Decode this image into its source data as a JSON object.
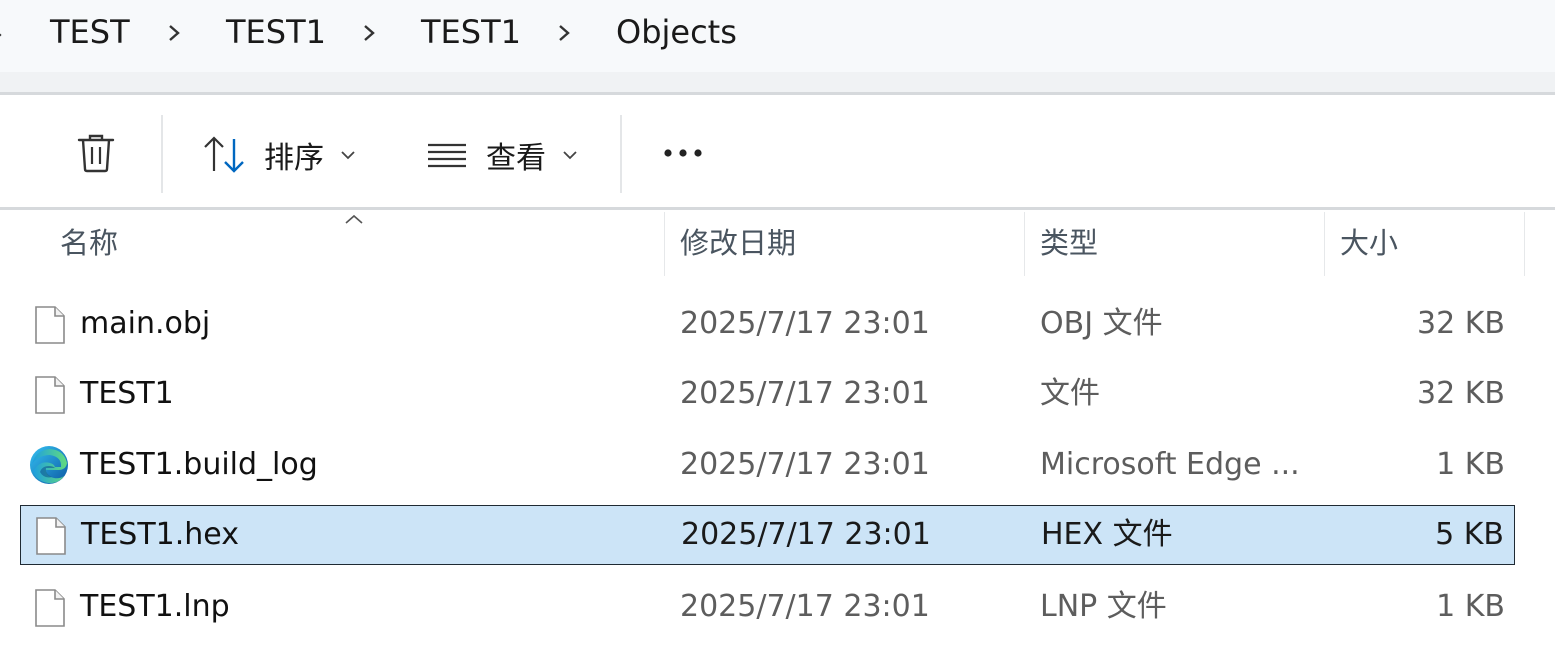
{
  "breadcrumb": {
    "items": [
      "TEST",
      "TEST1",
      "TEST1",
      "Objects"
    ]
  },
  "toolbar": {
    "delete_icon": "trash-icon",
    "sort_label": "排序",
    "view_label": "查看",
    "more_label": "•••"
  },
  "columns": {
    "name": "名称",
    "date": "修改日期",
    "type": "类型",
    "size": "大小"
  },
  "files": [
    {
      "name": "main.obj",
      "date": "2025/7/17 23:01",
      "type": "OBJ 文件",
      "size": "32 KB",
      "icon": "generic-file-icon",
      "selected": false
    },
    {
      "name": "TEST1",
      "date": "2025/7/17 23:01",
      "type": "文件",
      "size": "32 KB",
      "icon": "generic-file-icon",
      "selected": false
    },
    {
      "name": "TEST1.build_log",
      "date": "2025/7/17 23:01",
      "type": "Microsoft Edge ...",
      "size": "1 KB",
      "icon": "edge-browser-icon",
      "selected": false
    },
    {
      "name": "TEST1.hex",
      "date": "2025/7/17 23:01",
      "type": "HEX 文件",
      "size": "5 KB",
      "icon": "generic-file-icon",
      "selected": true
    },
    {
      "name": "TEST1.lnp",
      "date": "2025/7/17 23:01",
      "type": "LNP 文件",
      "size": "1 KB",
      "icon": "generic-file-icon",
      "selected": false
    }
  ],
  "colors": {
    "selection": "#cce4f7",
    "accent": "#0067c0"
  }
}
